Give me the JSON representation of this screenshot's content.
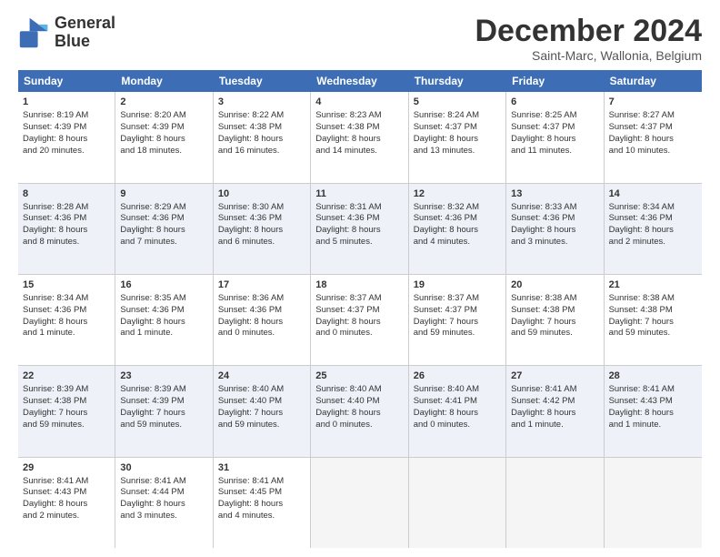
{
  "header": {
    "logo_line1": "General",
    "logo_line2": "Blue",
    "month": "December 2024",
    "location": "Saint-Marc, Wallonia, Belgium"
  },
  "weekdays": [
    "Sunday",
    "Monday",
    "Tuesday",
    "Wednesday",
    "Thursday",
    "Friday",
    "Saturday"
  ],
  "rows": [
    [
      {
        "day": "1",
        "lines": [
          "Sunrise: 8:19 AM",
          "Sunset: 4:39 PM",
          "Daylight: 8 hours",
          "and 20 minutes."
        ]
      },
      {
        "day": "2",
        "lines": [
          "Sunrise: 8:20 AM",
          "Sunset: 4:39 PM",
          "Daylight: 8 hours",
          "and 18 minutes."
        ]
      },
      {
        "day": "3",
        "lines": [
          "Sunrise: 8:22 AM",
          "Sunset: 4:38 PM",
          "Daylight: 8 hours",
          "and 16 minutes."
        ]
      },
      {
        "day": "4",
        "lines": [
          "Sunrise: 8:23 AM",
          "Sunset: 4:38 PM",
          "Daylight: 8 hours",
          "and 14 minutes."
        ]
      },
      {
        "day": "5",
        "lines": [
          "Sunrise: 8:24 AM",
          "Sunset: 4:37 PM",
          "Daylight: 8 hours",
          "and 13 minutes."
        ]
      },
      {
        "day": "6",
        "lines": [
          "Sunrise: 8:25 AM",
          "Sunset: 4:37 PM",
          "Daylight: 8 hours",
          "and 11 minutes."
        ]
      },
      {
        "day": "7",
        "lines": [
          "Sunrise: 8:27 AM",
          "Sunset: 4:37 PM",
          "Daylight: 8 hours",
          "and 10 minutes."
        ]
      }
    ],
    [
      {
        "day": "8",
        "lines": [
          "Sunrise: 8:28 AM",
          "Sunset: 4:36 PM",
          "Daylight: 8 hours",
          "and 8 minutes."
        ]
      },
      {
        "day": "9",
        "lines": [
          "Sunrise: 8:29 AM",
          "Sunset: 4:36 PM",
          "Daylight: 8 hours",
          "and 7 minutes."
        ]
      },
      {
        "day": "10",
        "lines": [
          "Sunrise: 8:30 AM",
          "Sunset: 4:36 PM",
          "Daylight: 8 hours",
          "and 6 minutes."
        ]
      },
      {
        "day": "11",
        "lines": [
          "Sunrise: 8:31 AM",
          "Sunset: 4:36 PM",
          "Daylight: 8 hours",
          "and 5 minutes."
        ]
      },
      {
        "day": "12",
        "lines": [
          "Sunrise: 8:32 AM",
          "Sunset: 4:36 PM",
          "Daylight: 8 hours",
          "and 4 minutes."
        ]
      },
      {
        "day": "13",
        "lines": [
          "Sunrise: 8:33 AM",
          "Sunset: 4:36 PM",
          "Daylight: 8 hours",
          "and 3 minutes."
        ]
      },
      {
        "day": "14",
        "lines": [
          "Sunrise: 8:34 AM",
          "Sunset: 4:36 PM",
          "Daylight: 8 hours",
          "and 2 minutes."
        ]
      }
    ],
    [
      {
        "day": "15",
        "lines": [
          "Sunrise: 8:34 AM",
          "Sunset: 4:36 PM",
          "Daylight: 8 hours",
          "and 1 minute."
        ]
      },
      {
        "day": "16",
        "lines": [
          "Sunrise: 8:35 AM",
          "Sunset: 4:36 PM",
          "Daylight: 8 hours",
          "and 1 minute."
        ]
      },
      {
        "day": "17",
        "lines": [
          "Sunrise: 8:36 AM",
          "Sunset: 4:36 PM",
          "Daylight: 8 hours",
          "and 0 minutes."
        ]
      },
      {
        "day": "18",
        "lines": [
          "Sunrise: 8:37 AM",
          "Sunset: 4:37 PM",
          "Daylight: 8 hours",
          "and 0 minutes."
        ]
      },
      {
        "day": "19",
        "lines": [
          "Sunrise: 8:37 AM",
          "Sunset: 4:37 PM",
          "Daylight: 7 hours",
          "and 59 minutes."
        ]
      },
      {
        "day": "20",
        "lines": [
          "Sunrise: 8:38 AM",
          "Sunset: 4:38 PM",
          "Daylight: 7 hours",
          "and 59 minutes."
        ]
      },
      {
        "day": "21",
        "lines": [
          "Sunrise: 8:38 AM",
          "Sunset: 4:38 PM",
          "Daylight: 7 hours",
          "and 59 minutes."
        ]
      }
    ],
    [
      {
        "day": "22",
        "lines": [
          "Sunrise: 8:39 AM",
          "Sunset: 4:38 PM",
          "Daylight: 7 hours",
          "and 59 minutes."
        ]
      },
      {
        "day": "23",
        "lines": [
          "Sunrise: 8:39 AM",
          "Sunset: 4:39 PM",
          "Daylight: 7 hours",
          "and 59 minutes."
        ]
      },
      {
        "day": "24",
        "lines": [
          "Sunrise: 8:40 AM",
          "Sunset: 4:40 PM",
          "Daylight: 7 hours",
          "and 59 minutes."
        ]
      },
      {
        "day": "25",
        "lines": [
          "Sunrise: 8:40 AM",
          "Sunset: 4:40 PM",
          "Daylight: 8 hours",
          "and 0 minutes."
        ]
      },
      {
        "day": "26",
        "lines": [
          "Sunrise: 8:40 AM",
          "Sunset: 4:41 PM",
          "Daylight: 8 hours",
          "and 0 minutes."
        ]
      },
      {
        "day": "27",
        "lines": [
          "Sunrise: 8:41 AM",
          "Sunset: 4:42 PM",
          "Daylight: 8 hours",
          "and 1 minute."
        ]
      },
      {
        "day": "28",
        "lines": [
          "Sunrise: 8:41 AM",
          "Sunset: 4:43 PM",
          "Daylight: 8 hours",
          "and 1 minute."
        ]
      }
    ],
    [
      {
        "day": "29",
        "lines": [
          "Sunrise: 8:41 AM",
          "Sunset: 4:43 PM",
          "Daylight: 8 hours",
          "and 2 minutes."
        ]
      },
      {
        "day": "30",
        "lines": [
          "Sunrise: 8:41 AM",
          "Sunset: 4:44 PM",
          "Daylight: 8 hours",
          "and 3 minutes."
        ]
      },
      {
        "day": "31",
        "lines": [
          "Sunrise: 8:41 AM",
          "Sunset: 4:45 PM",
          "Daylight: 8 hours",
          "and 4 minutes."
        ]
      },
      null,
      null,
      null,
      null
    ]
  ]
}
